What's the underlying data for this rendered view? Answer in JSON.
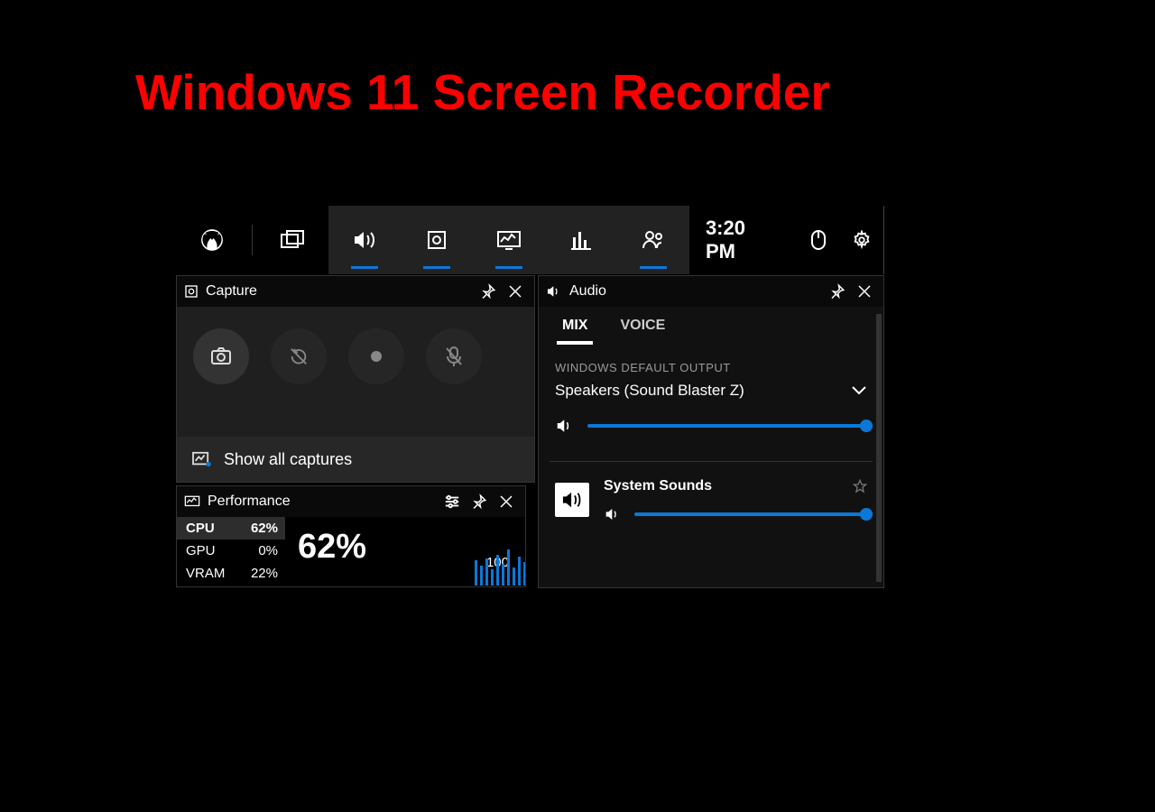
{
  "title": "Windows 11 Screen Recorder",
  "toolbar": {
    "icons": [
      "xbox",
      "widgets",
      "audio",
      "capture",
      "performance",
      "resources",
      "social"
    ],
    "active": [
      "audio",
      "capture",
      "performance",
      "social"
    ],
    "time": "3:20 PM"
  },
  "capture": {
    "title": "Capture",
    "show_all": "Show all captures"
  },
  "performance": {
    "title": "Performance",
    "rows": [
      {
        "label": "CPU",
        "value": "62%"
      },
      {
        "label": "GPU",
        "value": "0%"
      },
      {
        "label": "VRAM",
        "value": "22%"
      }
    ],
    "big": "62%",
    "scale_max": "100"
  },
  "audio": {
    "title": "Audio",
    "tabs": {
      "mix": "MIX",
      "voice": "VOICE",
      "active": "mix"
    },
    "section": "WINDOWS DEFAULT OUTPUT",
    "device": "Speakers (Sound Blaster Z)",
    "system_sounds": "System Sounds",
    "master_volume": 100,
    "system_volume": 100
  }
}
